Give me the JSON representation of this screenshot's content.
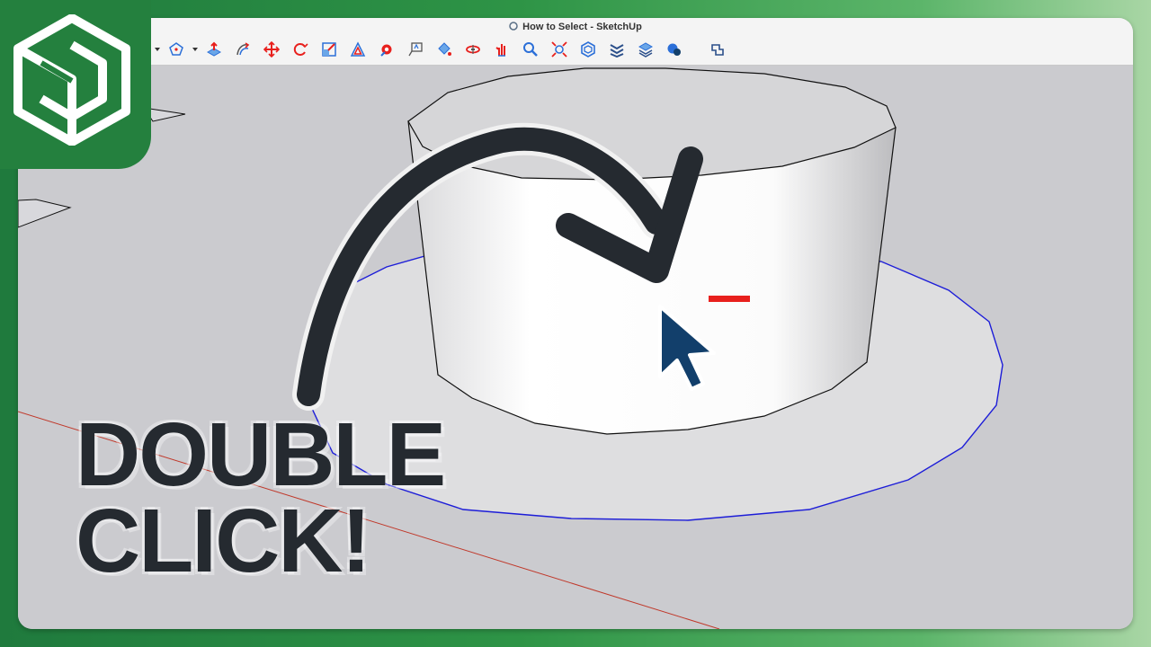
{
  "window": {
    "title": "How to Select - SketchUp"
  },
  "toolbar": {
    "tools": [
      {
        "name": "dropdown-caret-icon"
      },
      {
        "name": "polygon-icon"
      },
      {
        "name": "dropdown-caret-icon"
      },
      {
        "name": "push-pull-icon"
      },
      {
        "name": "follow-me-icon"
      },
      {
        "name": "move-icon"
      },
      {
        "name": "rotate-icon"
      },
      {
        "name": "scale-icon"
      },
      {
        "name": "offset-icon"
      },
      {
        "name": "tape-measure-icon"
      },
      {
        "name": "text-icon"
      },
      {
        "name": "paint-bucket-icon"
      },
      {
        "name": "orbit-icon"
      },
      {
        "name": "pan-icon"
      },
      {
        "name": "zoom-icon"
      },
      {
        "name": "zoom-extents-icon"
      },
      {
        "name": "3d-warehouse-icon"
      },
      {
        "name": "extension-warehouse-icon"
      },
      {
        "name": "layout-icon"
      },
      {
        "name": "extension-manager-icon"
      },
      {
        "name": "trimble-connect-icon"
      }
    ]
  },
  "overlay": {
    "headline_line1": "DOUBLE",
    "headline_line2": "CLICK!"
  },
  "colors": {
    "brand_green": "#24803e",
    "arrow": "#252a30",
    "selection_blue": "#1d1dd8",
    "cursor_navy": "#123f6b",
    "accent_red": "#e8201d"
  }
}
